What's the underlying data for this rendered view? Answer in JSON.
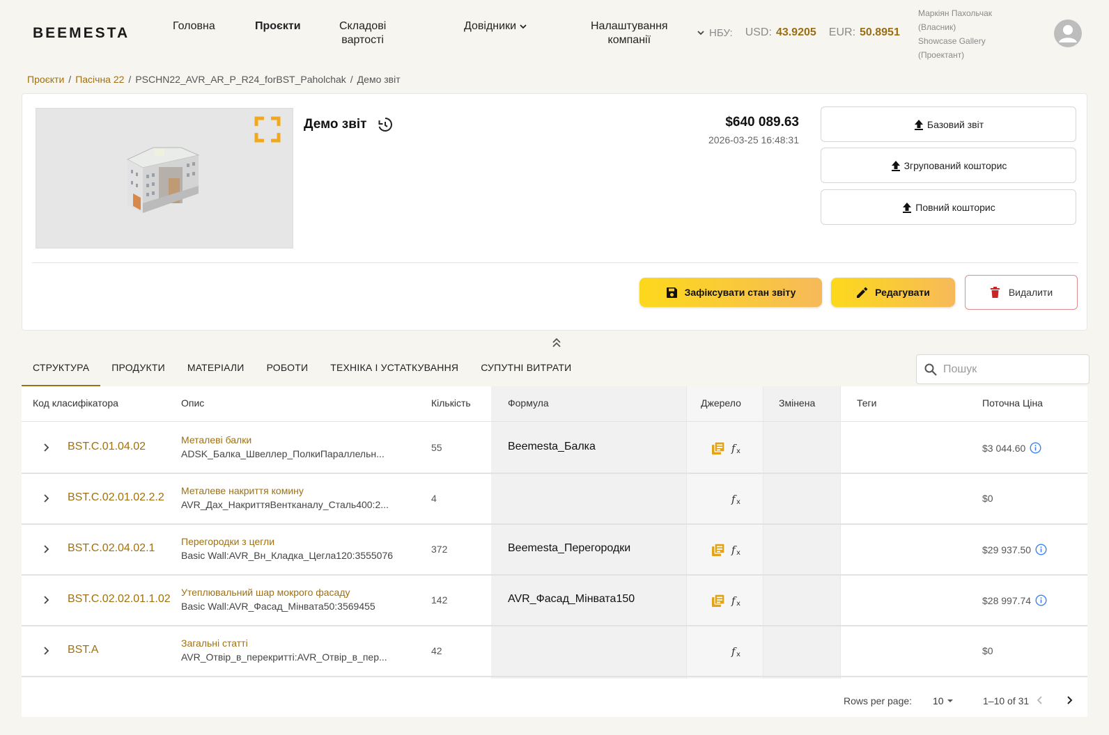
{
  "header": {
    "logo": "BEEMESTA",
    "nav": [
      {
        "line1": "Головна",
        "line2": ""
      },
      {
        "line1": "Проєкти",
        "line2": ""
      },
      {
        "line1": "Складові",
        "line2": "вартості"
      },
      {
        "line1": "Довідники",
        "line2": ""
      },
      {
        "line1": "Налаштування",
        "line2": "компанії"
      }
    ],
    "rates": {
      "label": "НБУ:",
      "usd_label": "USD:",
      "usd": "43.9205",
      "eur_label": "EUR:",
      "eur": "50.8951"
    },
    "user": {
      "name": "Маркіян Пахольчак",
      "role1": "(Власник)",
      "org": "Showcase Gallery",
      "role2": "(Проектант)"
    }
  },
  "breadcrumb": [
    "Проєкти",
    "Пасічна 22",
    "PSCHN22_AVR_AR_P_R24_forBST_Paholchak",
    "Демо звіт"
  ],
  "report": {
    "title": "Демо звіт",
    "total": "$640 089.63",
    "timestamp": "2026-03-25 16:48:31",
    "exports": [
      "Базовий звіт",
      "Згрупований кошторис",
      "Повний кошторис"
    ],
    "fix_label": "Зафіксувати стан звіту",
    "edit_label": "Редагувати",
    "delete_label": "Видалити"
  },
  "tabs": [
    "СТРУКТУРА",
    "ПРОДУКТИ",
    "МАТЕРІАЛИ",
    "РОБОТИ",
    "ТЕХНІКА І УСТАТКУВАННЯ",
    "СУПУТНІ ВИТРАТИ"
  ],
  "search": {
    "placeholder": "Пошук"
  },
  "table": {
    "headers": [
      "Код класифікатора",
      "Опис",
      "Кількість",
      "Формула",
      "Джерело",
      "Змінена",
      "Теги",
      "Поточна Ціна"
    ],
    "rows": [
      {
        "code": "BST.C.01.04.02",
        "desc1": "Металеві балки",
        "desc2": "ADSK_Балка_Швеллер_ПолкиПараллельн...",
        "qty": "55",
        "formula": "Beemesta_Балка",
        "lib": true,
        "price": "$3 044.60",
        "info": true
      },
      {
        "code": "BST.C.02.01.02.2.2",
        "desc1": "Металеве накриття комину",
        "desc2": "AVR_Дах_НакриттяВентканалу_Сталь400:2...",
        "qty": "4",
        "formula": "",
        "lib": false,
        "price": "$0",
        "info": false
      },
      {
        "code": "BST.C.02.04.02.1",
        "desc1": "Перегородки з цегли",
        "desc2": "Basic Wall:AVR_Вн_Кладка_Цегла120:3555076",
        "qty": "372",
        "formula": "Beemesta_Перегородки",
        "lib": true,
        "price": "$29 937.50",
        "info": true
      },
      {
        "code": "BST.C.02.02.01.1.02",
        "desc1": "Утеплювальний шар мокрого фасаду",
        "desc2": "Basic Wall:AVR_Фасад_Мінвата50:3569455",
        "qty": "142",
        "formula": "AVR_Фасад_Мінвата150",
        "lib": true,
        "price": "$28 997.74",
        "info": true
      },
      {
        "code": "BST.A",
        "desc1": "Загальні статті",
        "desc2": "AVR_Отвір_в_перекритті:AVR_Отвір_в_пер...",
        "qty": "42",
        "formula": "",
        "lib": false,
        "price": "$0",
        "info": false
      }
    ]
  },
  "pagination": {
    "rows_per_page_label": "Rows per page:",
    "rows_per_page": "10",
    "range": "1–10 of 31"
  },
  "colors": {
    "accent": "#a0700f",
    "yellow": "#fcd81c",
    "info": "#3b82f6"
  }
}
